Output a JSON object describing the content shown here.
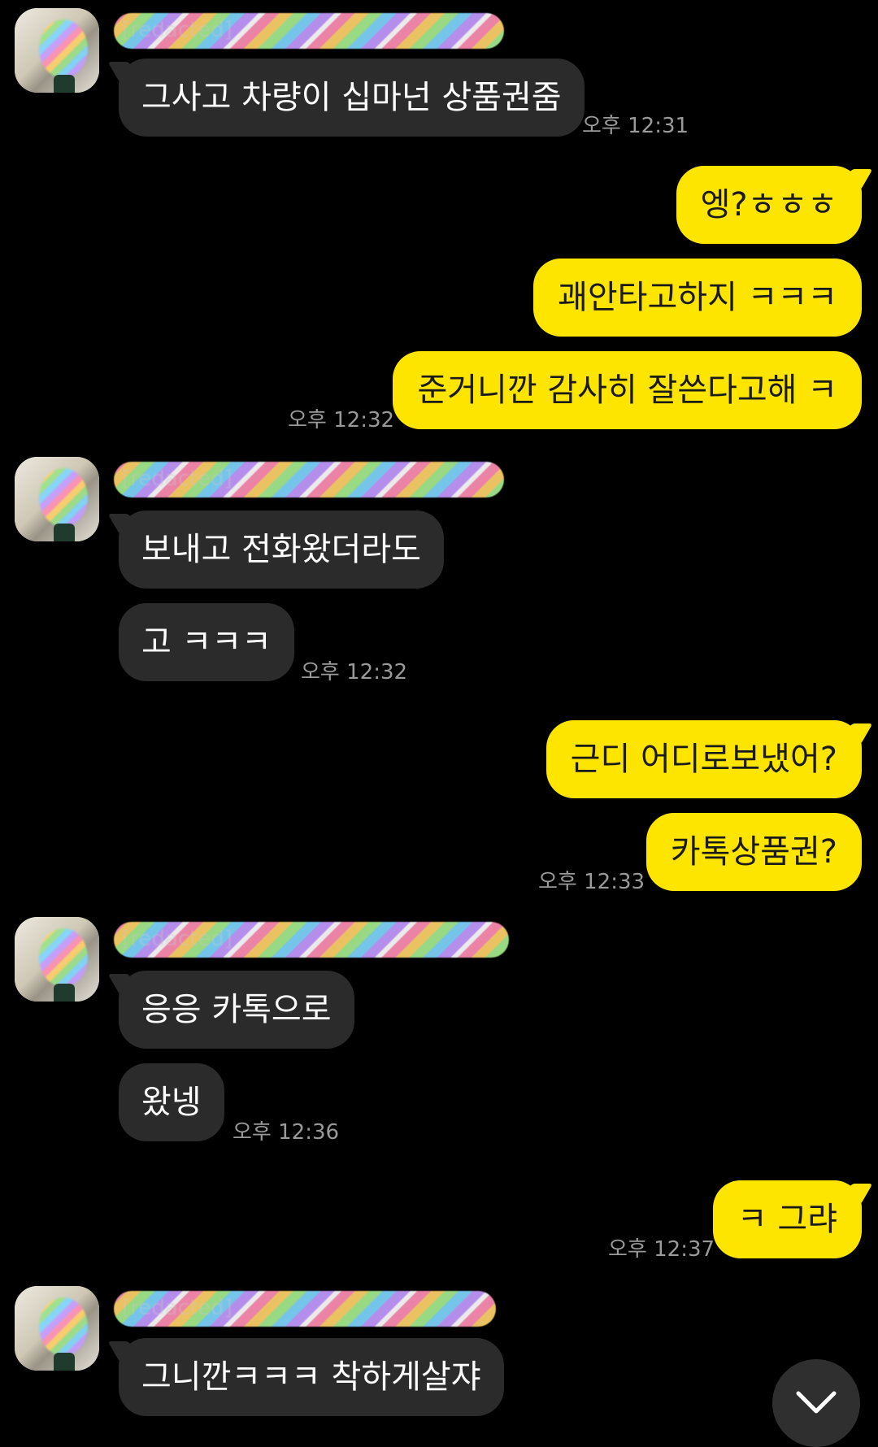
{
  "messages": [
    {
      "side": "in",
      "sender_name": "[redacted]",
      "text": "그사고 차량이 십마넌 상품권줌",
      "time": "오후 12:31"
    },
    {
      "side": "out",
      "text": "엥?ㅎㅎㅎ"
    },
    {
      "side": "out",
      "text": "괘안타고하지 ㅋㅋㅋ"
    },
    {
      "side": "out",
      "text": "준거니깐 감사히 잘쓴다고해 ㅋ",
      "time": "오후 12:32"
    },
    {
      "side": "in",
      "sender_name": "[redacted]",
      "text": "보내고 전화왔더라도"
    },
    {
      "side": "in",
      "text": "고 ㅋㅋㅋ",
      "time": "오후 12:32"
    },
    {
      "side": "out",
      "text": "근디 어디로보냈어?"
    },
    {
      "side": "out",
      "text": "카톡상품권?",
      "time": "오후 12:33"
    },
    {
      "side": "in",
      "sender_name": "[redacted]",
      "text": "응응 카톡으로"
    },
    {
      "side": "in",
      "text": "왔넹",
      "time": "오후 12:36"
    },
    {
      "side": "out",
      "text": "ㅋ 그랴",
      "time": "오후 12:37"
    },
    {
      "side": "in",
      "sender_name": "[redacted]",
      "text": "그니깐ㅋㅋㅋ 착하게살쟈"
    }
  ],
  "colors": {
    "background": "#000000",
    "incoming_bubble": "#2b2b2b",
    "outgoing_bubble": "#fee500",
    "timestamp": "#9a9a9a"
  },
  "icons": {
    "scroll_down": "chevron-down-icon",
    "avatar": "profile-avatar"
  }
}
